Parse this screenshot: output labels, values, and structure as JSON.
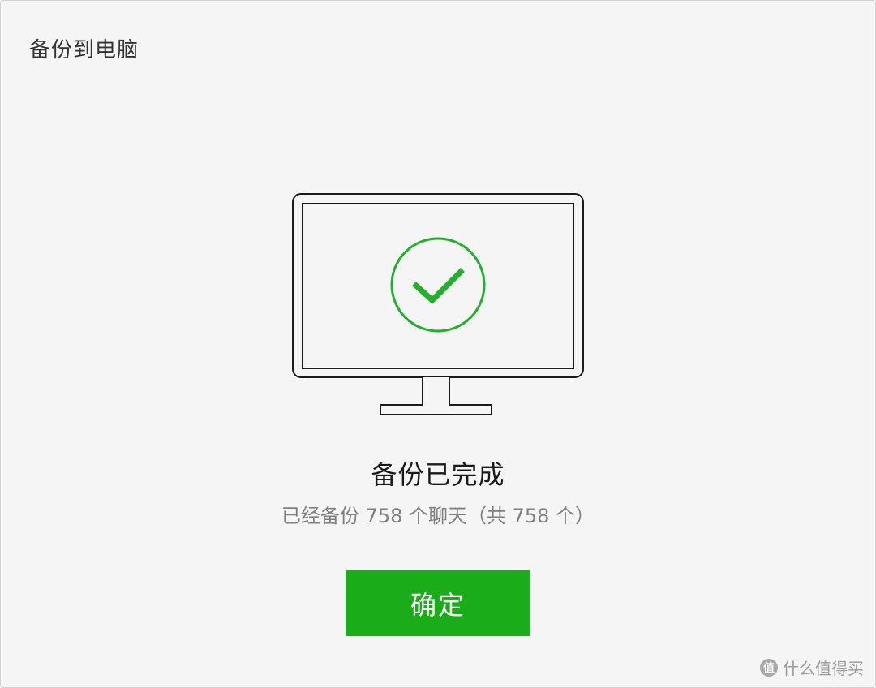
{
  "window": {
    "title": "备份到电脑"
  },
  "status": {
    "title": "备份已完成",
    "detail": "已经备份 758 个聊天（共 758 个）"
  },
  "actions": {
    "confirm_label": "确定"
  },
  "watermark": {
    "text": "什么值得买"
  },
  "icons": {
    "illustration": "monitor-icon",
    "success": "check-circle-icon"
  },
  "colors": {
    "accent": "#1aad19",
    "check": "#22b02c",
    "background": "#f5f5f5",
    "outline": "#1a1a1a"
  }
}
